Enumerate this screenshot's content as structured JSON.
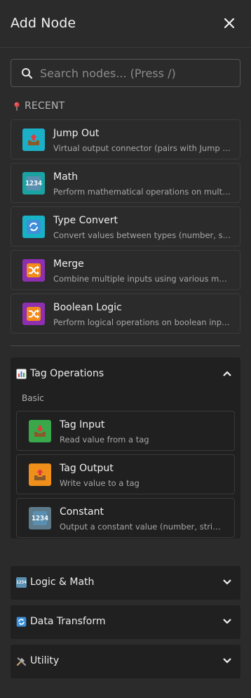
{
  "header": {
    "title": "Add Node"
  },
  "search": {
    "placeholder": "Search nodes... (Press /)",
    "value": ""
  },
  "recent": {
    "label": "RECENT",
    "items": [
      {
        "title": "Jump Out",
        "description": "Virtual output connector (pairs with Jump In)",
        "icon": "outbox-tray-icon",
        "color": "#1cb0c8"
      },
      {
        "title": "Math",
        "description": "Perform mathematical operations on multiple inputs",
        "icon": "numbers-icon",
        "color": "#1aa3a3"
      },
      {
        "title": "Type Convert",
        "description": "Convert values between types (number, string, boolean)",
        "icon": "arrows-cycle-icon",
        "color": "#18b2c6"
      },
      {
        "title": "Merge",
        "description": "Combine multiple inputs using various methods",
        "icon": "shuffle-icon",
        "color": "#8e2fb0"
      },
      {
        "title": "Boolean Logic",
        "description": "Perform logical operations on boolean inputs",
        "icon": "shuffle-icon",
        "color": "#8e2fb0"
      }
    ]
  },
  "categories": {
    "tag_operations": {
      "label": "Tag Operations",
      "icon": "bar-chart-icon",
      "expanded": true,
      "section": "Basic",
      "items": [
        {
          "title": "Tag Input",
          "description": "Read value from a tag",
          "icon": "inbox-tray-icon",
          "color": "#3aa84a"
        },
        {
          "title": "Tag Output",
          "description": "Write value to a tag",
          "icon": "outbox-tray-icon",
          "color": "#f0901a"
        },
        {
          "title": "Constant",
          "description": "Output a constant value (number, string, boolean)",
          "icon": "numbers-icon",
          "color": "#5c7a8a"
        }
      ]
    },
    "logic_math": {
      "label": "Logic & Math",
      "icon": "numbers-icon",
      "expanded": false
    },
    "data_transform": {
      "label": "Data Transform",
      "icon": "arrows-cycle-icon",
      "expanded": false
    },
    "utility": {
      "label": "Utility",
      "icon": "tools-icon",
      "expanded": false
    }
  }
}
